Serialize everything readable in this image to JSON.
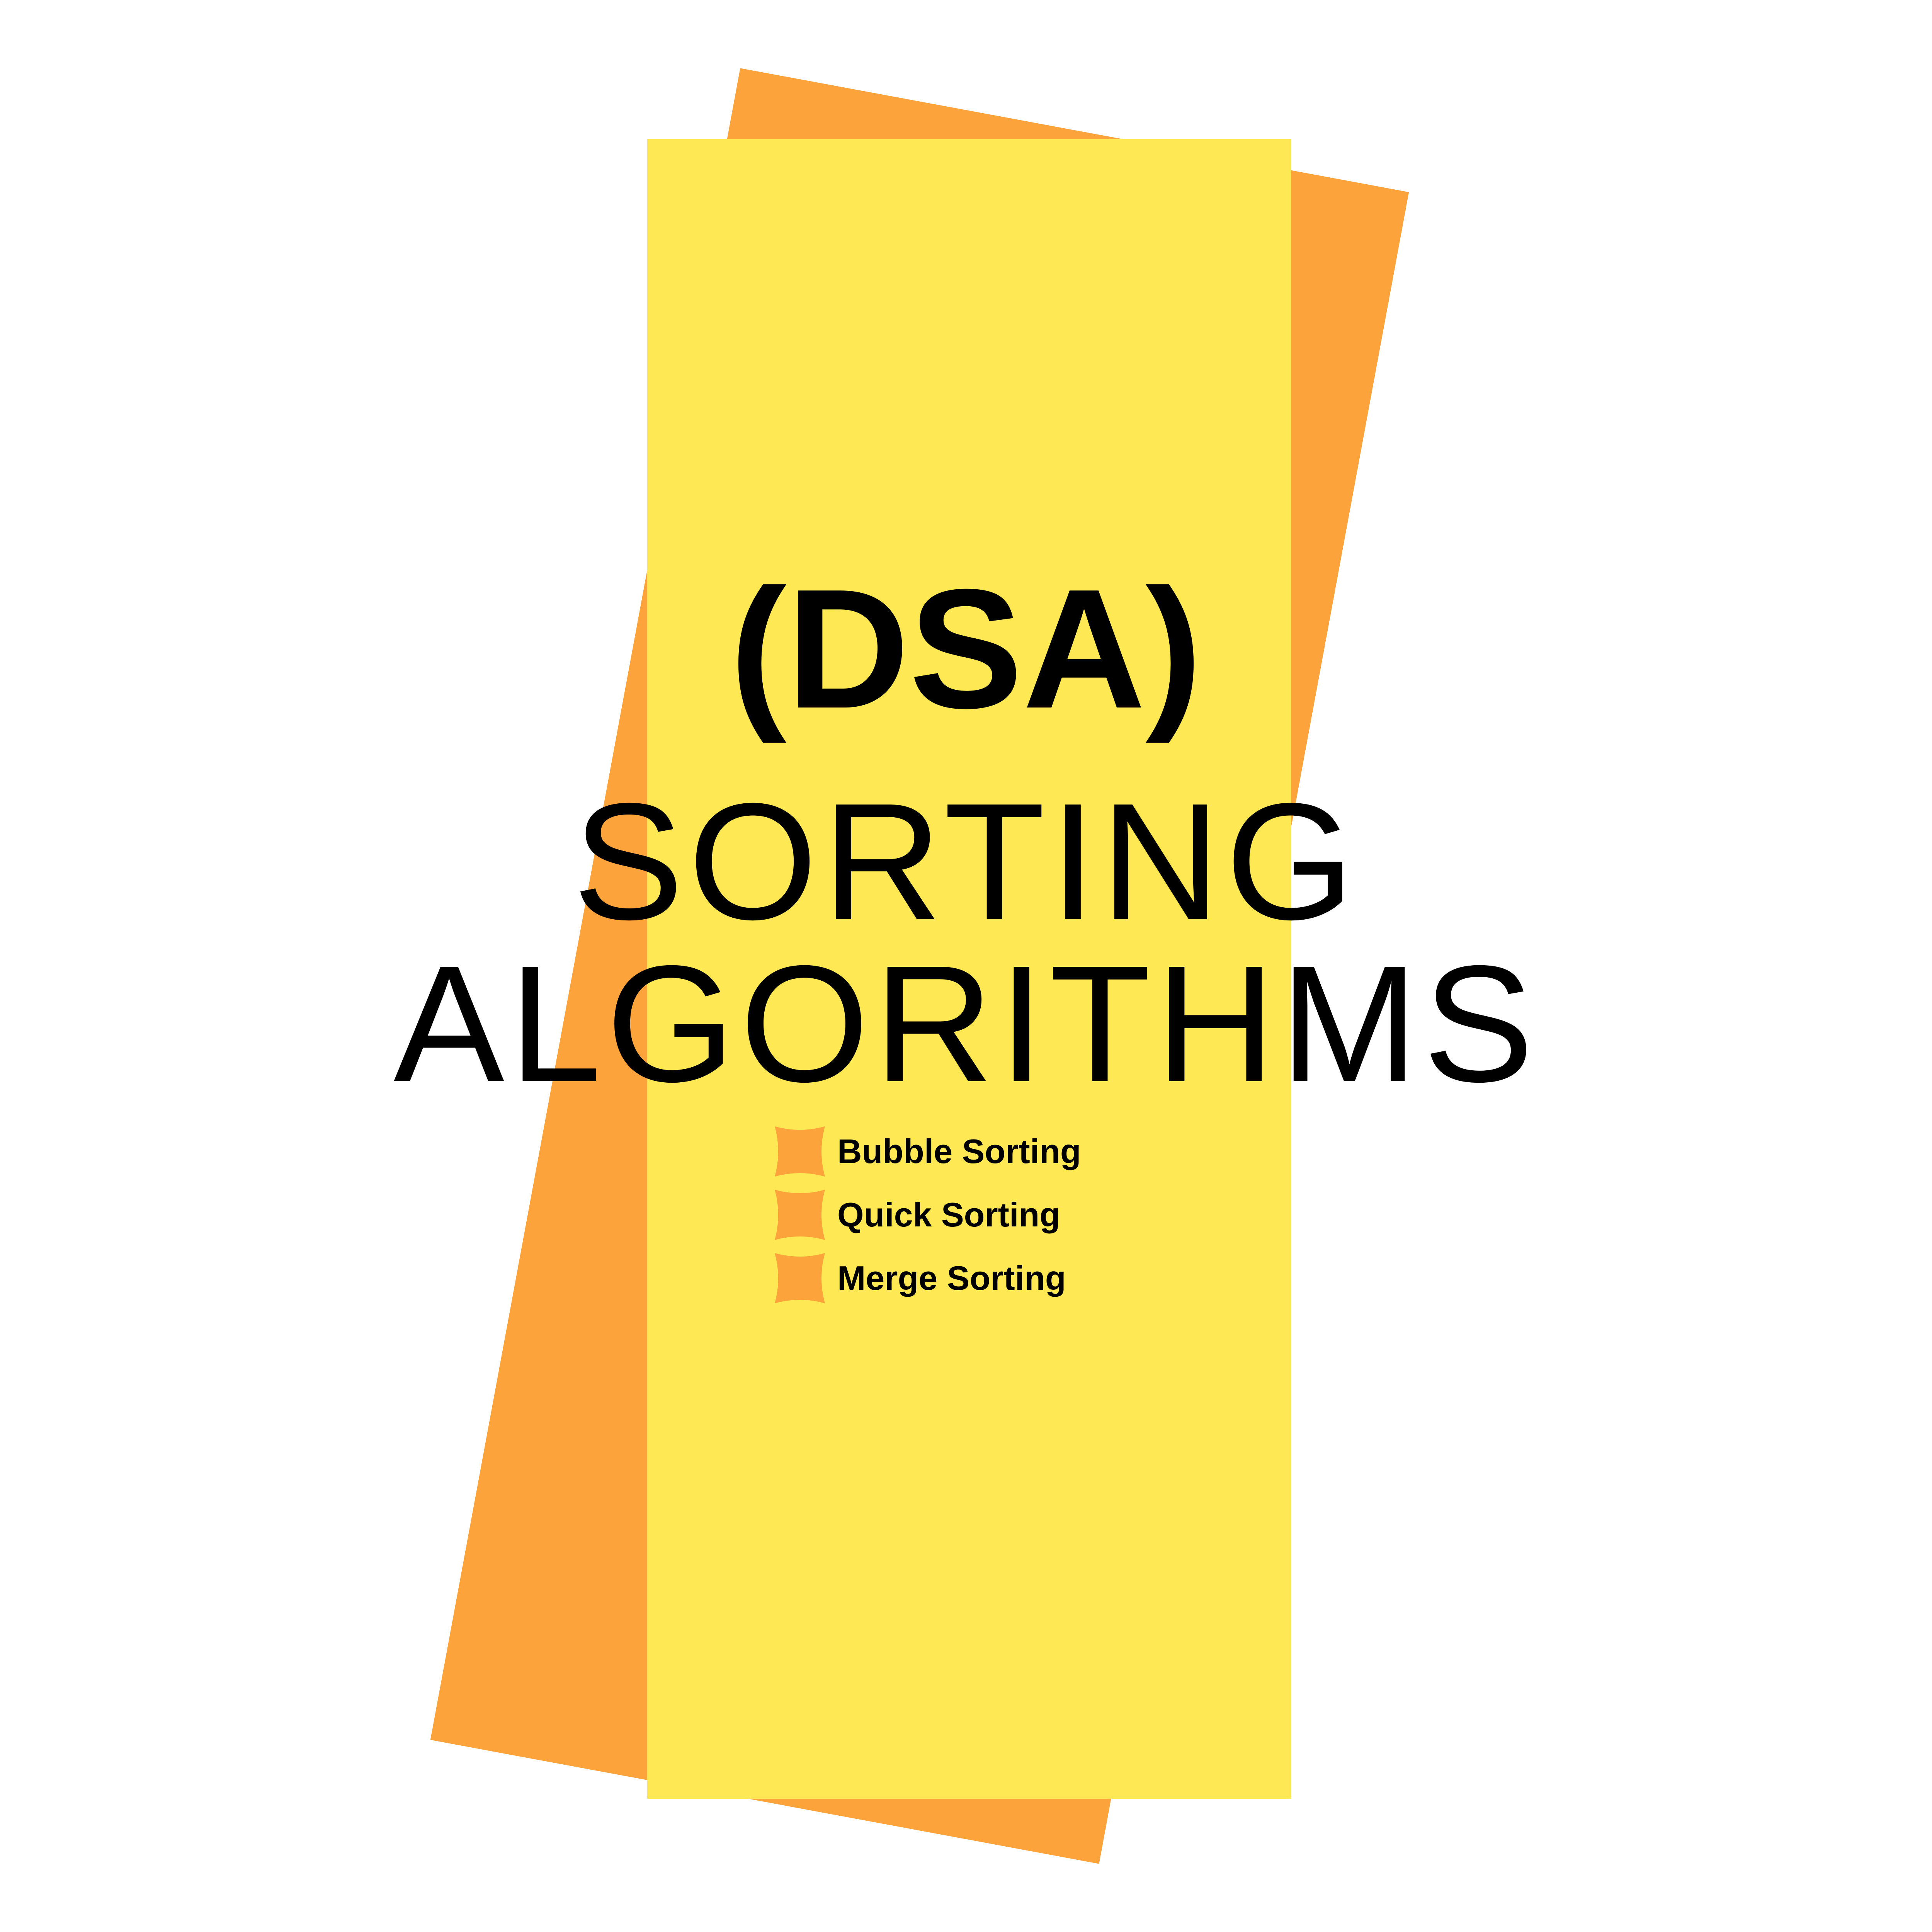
{
  "colors": {
    "background": "#ffffff",
    "back_card": "#FDA33B",
    "front_card": "#FEE853",
    "bullet": "#FDA33B",
    "text": "#000000"
  },
  "title": {
    "abbreviation": "(DSA)",
    "line1": "SORTING",
    "line2": "ALGORITHMS"
  },
  "topics": [
    {
      "label": "Bubble Sorting",
      "icon": "concave-square-bullet-icon"
    },
    {
      "label": "Quick Sorting",
      "icon": "concave-square-bullet-icon"
    },
    {
      "label": "Merge Sorting",
      "icon": "concave-square-bullet-icon"
    }
  ]
}
